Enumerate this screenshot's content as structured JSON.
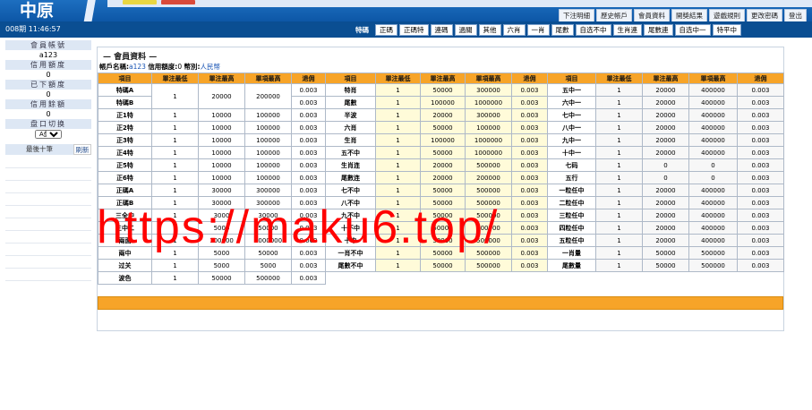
{
  "header": {
    "logo": "中原",
    "top_links": [
      "下注明細",
      "歷史帳戶",
      "會員資料",
      "開獎結果",
      "遊戲規則",
      "更改密碼",
      "登出"
    ],
    "clock": "008期 11:46:57",
    "tabs": [
      "特碼",
      "正碼",
      "正碼特",
      "連碼",
      "過關",
      "其他",
      "六肖",
      "一肖",
      "尾數",
      "自选不中",
      "生肖連",
      "尾數連",
      "自选中一",
      "特平中"
    ],
    "active_tab": "特碼"
  },
  "sidebar": {
    "account_label": "會員帳號",
    "account_value": "a123",
    "credit_label": "信用額度",
    "credit_value": "0",
    "bet_label": "已下額度",
    "bet_value": "0",
    "balance_label": "信用餘額",
    "balance_value": "0",
    "plate_label": "盘口切换",
    "plate_value": "A盘",
    "last_ten_label": "最後十筆",
    "refresh_label": "刷新"
  },
  "main": {
    "title": "— 會員資料 —",
    "info_account_label": "帳戶名稱:",
    "info_account_value": "a123",
    "info_credit_label": "信用額度:",
    "info_credit_value": "0",
    "info_currency_label": "幣別:",
    "info_currency_value": "人民幣",
    "headers": [
      "項目",
      "單注最低",
      "單注最高",
      "單項最高",
      "退佣"
    ],
    "col1": [
      [
        "特碼A",
        "",
        "",
        "",
        ""
      ],
      [
        "特碼B",
        "1",
        "20000",
        "200000",
        "0.003"
      ],
      [
        "正1特",
        "1",
        "10000",
        "100000",
        "0.003"
      ],
      [
        "正2特",
        "1",
        "10000",
        "100000",
        "0.003"
      ],
      [
        "正3特",
        "1",
        "10000",
        "100000",
        "0.003"
      ],
      [
        "正4特",
        "1",
        "10000",
        "100000",
        "0.003"
      ],
      [
        "正5特",
        "1",
        "10000",
        "100000",
        "0.003"
      ],
      [
        "正6特",
        "1",
        "10000",
        "100000",
        "0.003"
      ],
      [
        "正碼A",
        "1",
        "30000",
        "300000",
        "0.003"
      ],
      [
        "正碼B",
        "1",
        "30000",
        "300000",
        "0.003"
      ],
      [
        "三全中",
        "1",
        "3000",
        "30000",
        "0.003"
      ],
      [
        "三中二",
        "1",
        "5000",
        "50000",
        "0.003"
      ],
      [
        "兩面",
        "1",
        "100000",
        "1000000",
        "0.003"
      ],
      [
        "兩中",
        "1",
        "5000",
        "50000",
        "0.003"
      ],
      [
        "过关",
        "1",
        "5000",
        "5000",
        "0.003"
      ],
      [
        "波色",
        "1",
        "50000",
        "500000",
        "0.003"
      ]
    ],
    "col1_first_rebate": "0.003",
    "col2": [
      [
        "特肖",
        "1",
        "50000",
        "300000",
        "0.003"
      ],
      [
        "尾數",
        "1",
        "100000",
        "1000000",
        "0.003"
      ],
      [
        "半波",
        "1",
        "20000",
        "300000",
        "0.003"
      ],
      [
        "六肖",
        "1",
        "50000",
        "100000",
        "0.003"
      ],
      [
        "生肖",
        "1",
        "100000",
        "1000000",
        "0.003"
      ],
      [
        "五不中",
        "1",
        "50000",
        "1000000",
        "0.003"
      ],
      [
        "生肖连",
        "1",
        "20000",
        "500000",
        "0.003"
      ],
      [
        "尾數连",
        "1",
        "20000",
        "200000",
        "0.003"
      ],
      [
        "七不中",
        "1",
        "50000",
        "500000",
        "0.003"
      ],
      [
        "八不中",
        "1",
        "50000",
        "500000",
        "0.003"
      ],
      [
        "九不中",
        "1",
        "50000",
        "500000",
        "0.003"
      ],
      [
        "十不中",
        "1",
        "50000",
        "500000",
        "0.003"
      ],
      [
        "十中",
        "1",
        "50000",
        "500000",
        "0.003"
      ],
      [
        "一肖不中",
        "1",
        "50000",
        "500000",
        "0.003"
      ],
      [
        "尾數不中",
        "1",
        "50000",
        "500000",
        "0.003"
      ]
    ],
    "col3": [
      [
        "五中一",
        "1",
        "20000",
        "400000",
        "0.003"
      ],
      [
        "六中一",
        "1",
        "20000",
        "400000",
        "0.003"
      ],
      [
        "七中一",
        "1",
        "20000",
        "400000",
        "0.003"
      ],
      [
        "八中一",
        "1",
        "20000",
        "400000",
        "0.003"
      ],
      [
        "九中一",
        "1",
        "20000",
        "400000",
        "0.003"
      ],
      [
        "十中一",
        "1",
        "20000",
        "400000",
        "0.003"
      ],
      [
        "七码",
        "1",
        "0",
        "0",
        "0.003"
      ],
      [
        "五行",
        "1",
        "0",
        "0",
        "0.003"
      ],
      [
        "一粒任中",
        "1",
        "20000",
        "400000",
        "0.003"
      ],
      [
        "二粒任中",
        "1",
        "20000",
        "400000",
        "0.003"
      ],
      [
        "三粒任中",
        "1",
        "20000",
        "400000",
        "0.003"
      ],
      [
        "四粒任中",
        "1",
        "20000",
        "400000",
        "0.003"
      ],
      [
        "五粒任中",
        "1",
        "20000",
        "400000",
        "0.003"
      ],
      [
        "一肖量",
        "1",
        "50000",
        "500000",
        "0.003"
      ],
      [
        "尾數量",
        "1",
        "50000",
        "500000",
        "0.003"
      ]
    ]
  },
  "watermark": "https://maku6.top/",
  "colors": {
    "header_blue": "#0d57a6",
    "table_header": "#f7a428",
    "yellow_cell": "#fffbd9",
    "watermark": "#ff0000"
  }
}
